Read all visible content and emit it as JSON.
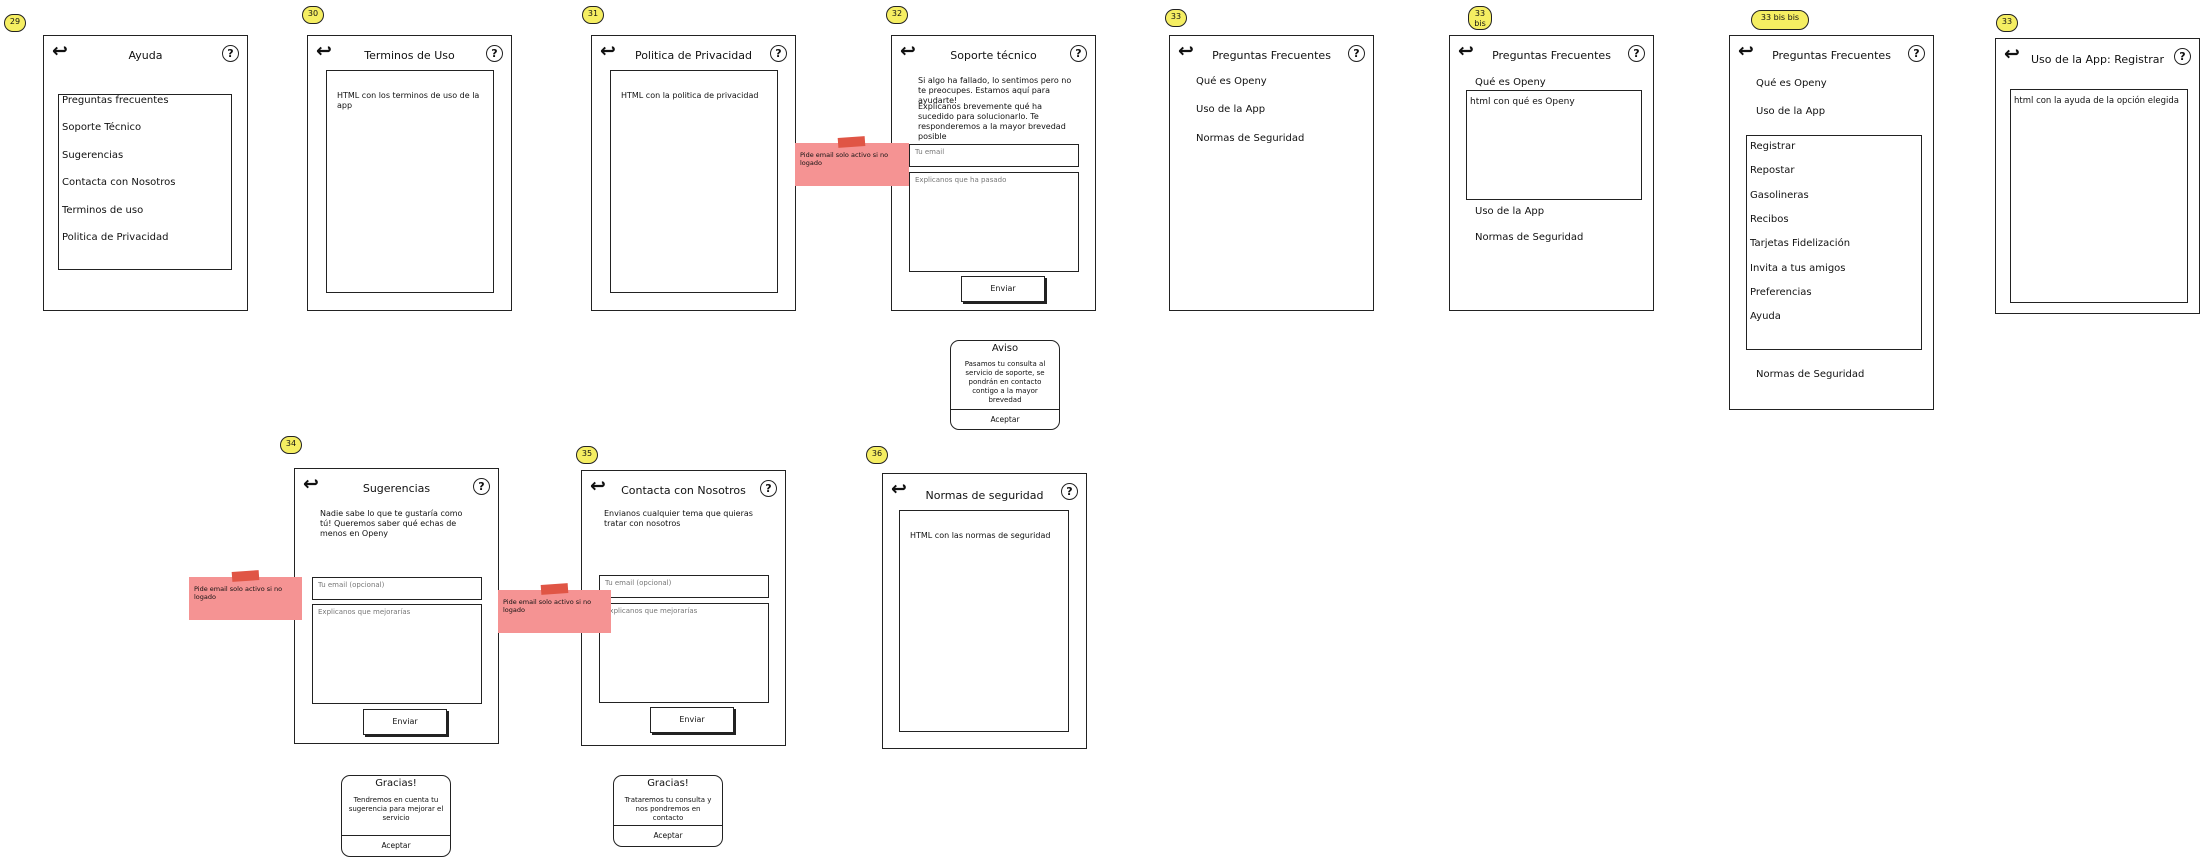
{
  "common": {
    "back_glyph": "↩",
    "help_glyph": "?"
  },
  "s29": {
    "badge": "29",
    "title": "Ayuda",
    "items": [
      "Preguntas frecuentes",
      "Soporte Técnico",
      "Sugerencias",
      "Contacta con Nosotros",
      "Terminos de uso",
      "Politica de Privacidad"
    ]
  },
  "s30": {
    "badge": "30",
    "title": "Terminos de Uso",
    "content": "HTML con los terminos de uso de la app"
  },
  "s31": {
    "badge": "31",
    "title": "Politica de Privacidad",
    "content": "HTML con la politica de privacidad"
  },
  "s32": {
    "badge": "32",
    "title": "Soporte técnico",
    "intro1": "Si algo ha fallado, lo sentimos pero no te preocupes. Estamos aquí para ayudarte!",
    "intro2": "Explicanos brevemente qué ha sucedido para solucionarlo. Te responderemos a la mayor brevedad posible",
    "email_placeholder": "Tu email",
    "message_placeholder": "Explicanos que ha pasado",
    "send": "Enviar",
    "note": "Pide email solo activo si no logado",
    "dialog": {
      "title": "Aviso",
      "body": "Pasamos tu consulta al servicio de soporte, se pondrán en contacto contigo a la mayor brevedad",
      "accept": "Aceptar"
    }
  },
  "s33": {
    "badge": "33",
    "title": "Preguntas Frecuentes",
    "items": [
      "Qué es Openy",
      "Uso de la App",
      "Normas de Seguridad"
    ]
  },
  "s33bis": {
    "badge": "33 bis",
    "title": "Preguntas Frecuentes",
    "item_open": "Qué es Openy",
    "content": "html con qué es Openy",
    "items_after": [
      "Uso de la App",
      "Normas de Seguridad"
    ]
  },
  "s33bisbis": {
    "badge": "33 bis bis",
    "title": "Preguntas Frecuentes",
    "items_before": [
      "Qué es Openy",
      "Uso de la App"
    ],
    "sub_items": [
      "Registrar",
      "Repostar",
      "Gasolineras",
      "Recibos",
      "Tarjetas Fidelización",
      "Invita a tus amigos",
      "Preferencias",
      "Ayuda"
    ],
    "item_after": "Normas de Seguridad"
  },
  "s33r": {
    "badge": "33",
    "title": "Uso de la App: Registrar",
    "content": "html con la ayuda de la opción elegida"
  },
  "s34": {
    "badge": "34",
    "title": "Sugerencias",
    "intro": "Nadie sabe lo que te gustaría como tú! Queremos saber qué echas de menos en Openy",
    "email_placeholder": "Tu email (opcional)",
    "message_placeholder": "Explicanos que mejorarías",
    "send": "Enviar",
    "note": "Pide email solo activo si no logado",
    "dialog": {
      "title": "Gracias!",
      "body": "Tendremos en cuenta tu sugerencia para mejorar el servicio",
      "accept": "Aceptar"
    }
  },
  "s35": {
    "badge": "35",
    "title": "Contacta con Nosotros",
    "intro": "Envianos cualquier tema que quieras tratar con nosotros",
    "email_placeholder": "Tu email (opcional)",
    "message_placeholder": "Explicanos que mejorarías",
    "send": "Enviar",
    "note": "Pide email solo activo si no logado",
    "dialog": {
      "title": "Gracias!",
      "body": "Trataremos tu consulta y nos pondremos en contacto",
      "accept": "Aceptar"
    }
  },
  "s36": {
    "badge": "36",
    "title": "Normas de seguridad",
    "content": "HTML con las normas de seguridad"
  }
}
